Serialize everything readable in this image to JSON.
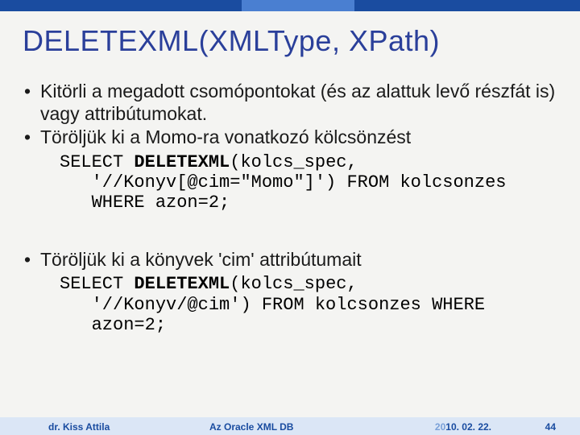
{
  "title": "DELETEXML(XMLType, XPath)",
  "bullets": {
    "b1": "Kitörli a megadott csomópontokat (és az alattuk levő részfát is) vagy attribútumokat.",
    "b2": "Töröljük ki a Momo-ra vonatkozó kölcsönzést",
    "b3": "Töröljük ki a könyvek 'cim' attribútumait"
  },
  "code1": {
    "line1a": "SELECT ",
    "line1b": "DELETEXML",
    "line1c": "(kolcs_spec,",
    "line2": "   '//Konyv[@cim=\"Momo\"]') FROM kolcsonzes",
    "line3": "   WHERE azon=2;"
  },
  "code2": {
    "line1a": "SELECT ",
    "line1b": "DELETEXML",
    "line1c": "(kolcs_spec,",
    "line2": "   '//Konyv/@cim') FROM kolcsonzes WHERE",
    "line3": "   azon=2;"
  },
  "footer": {
    "author": "dr. Kiss Attila",
    "center": "Az Oracle XML DB",
    "date_prefix": "20",
    "date_rest": "10. 02. 22.",
    "pagenum": "44"
  }
}
